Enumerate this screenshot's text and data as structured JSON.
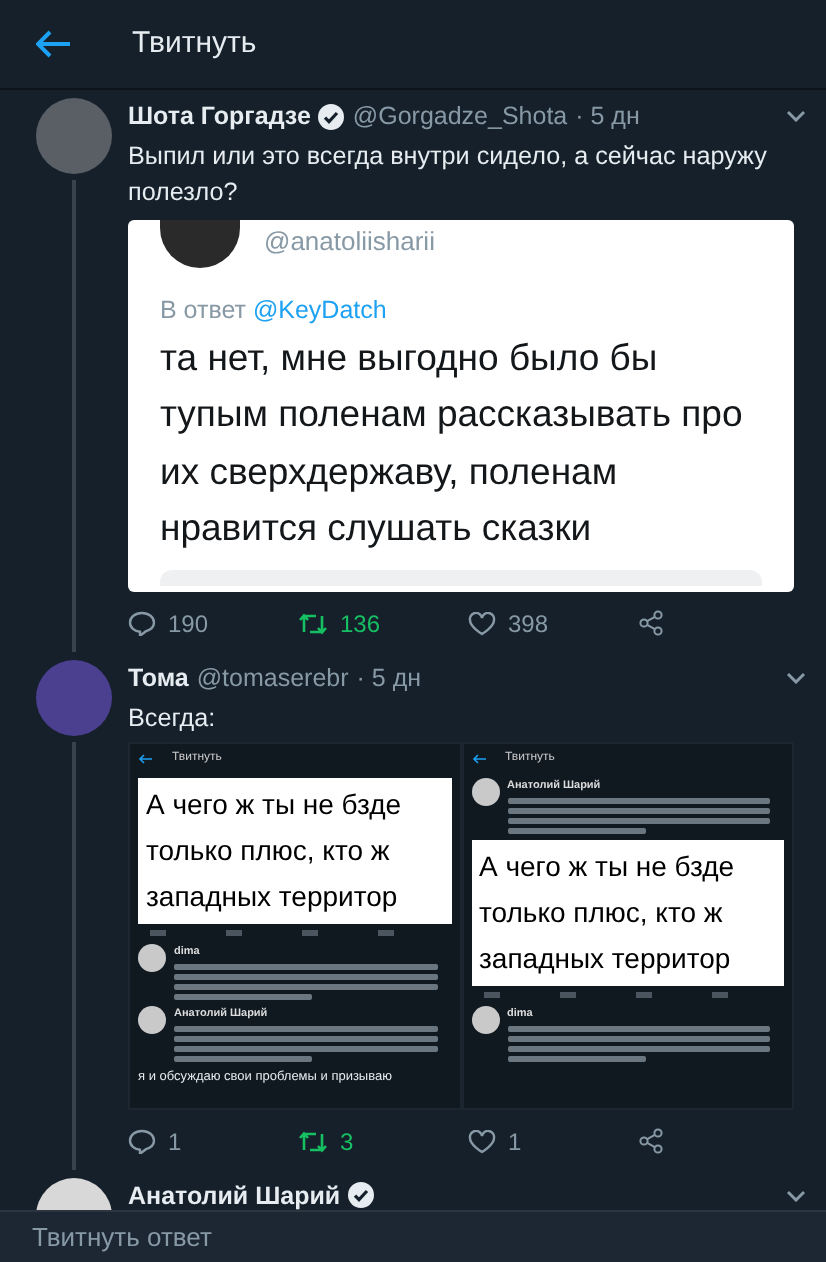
{
  "header": {
    "title": "Твитнуть"
  },
  "tweets": [
    {
      "name": "Шота Горгадзе",
      "verified": true,
      "handle": "@Gorgadze_Shota",
      "time": "· 5 дн",
      "text": "Выпил или это всегда внутри сидело, а сейчас наружу полезло?",
      "media": {
        "kind": "quote",
        "handle": "@anatoliisharii",
        "reply_label": "В ответ",
        "reply_to": "@KeyDatch",
        "lines": [
          "та нет, мне выгодно было бы",
          "тупым поленам рассказывать про",
          "их сверхдержаву, поленам",
          "нравится слушать сказки"
        ]
      },
      "actions": {
        "replies": "190",
        "retweets": "136",
        "retweeted": true,
        "likes": "398",
        "liked": false
      }
    },
    {
      "name": "Тома",
      "verified": false,
      "handle": "@tomaserebr",
      "time": "· 5 дн",
      "text": "Всегда:",
      "media": {
        "kind": "screenshots",
        "panels": [
          {
            "header": "Твитнуть",
            "blocks": [
              {
                "kind": "image",
                "lines": [
                  "А чего ж ты не бзде",
                  "только плюс, кто ж",
                  "западных территор"
                ]
              },
              {
                "kind": "tweet",
                "name": "dima"
              },
              {
                "kind": "tweet",
                "name": "Анатолий Шарий"
              },
              {
                "kind": "text",
                "text": "я и обсуждаю свои проблемы и призываю"
              }
            ]
          },
          {
            "header": "Твитнуть",
            "blocks": [
              {
                "kind": "tweet",
                "name": "Анатолий Шарий"
              },
              {
                "kind": "image",
                "lines": [
                  "А чего ж ты не бзде",
                  "только плюс, кто ж",
                  "западных территор"
                ]
              },
              {
                "kind": "tweet",
                "name": "dima"
              }
            ]
          }
        ]
      },
      "actions": {
        "replies": "1",
        "retweets": "3",
        "retweeted": true,
        "likes": "1",
        "liked": false
      }
    },
    {
      "name": "Анатолий Шарий",
      "verified": true
    }
  ],
  "reply_bar": {
    "placeholder": "Твитнуть ответ"
  }
}
